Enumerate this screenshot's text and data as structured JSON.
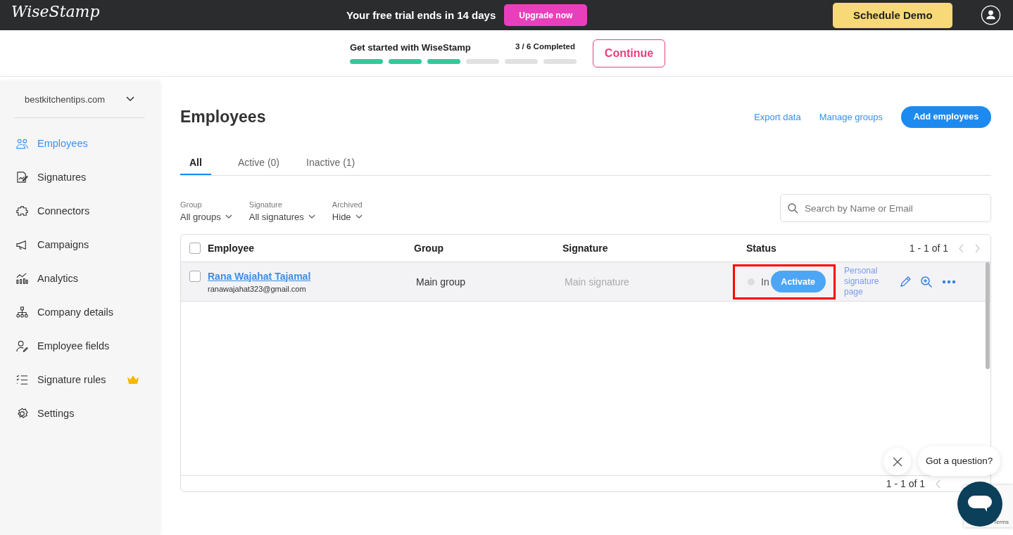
{
  "topbar": {
    "logo": "WiseStamp",
    "trial_message": "Your free trial ends in 14 days",
    "upgrade_button": "Upgrade now",
    "demo_button": "Schedule Demo"
  },
  "onboarding": {
    "title": "Get started with WiseStamp",
    "progress_text": "3 / 6 Completed",
    "steps": [
      {
        "completed": true
      },
      {
        "completed": true
      },
      {
        "completed": true
      },
      {
        "completed": false
      },
      {
        "completed": false
      },
      {
        "completed": false
      }
    ],
    "continue_button": "Continue"
  },
  "sidebar": {
    "account": "bestkitchentips.com",
    "items": [
      {
        "label": "Employees",
        "selected": true,
        "premium": false
      },
      {
        "label": "Signatures",
        "selected": false,
        "premium": false
      },
      {
        "label": "Connectors",
        "selected": false,
        "premium": false
      },
      {
        "label": "Campaigns",
        "selected": false,
        "premium": false
      },
      {
        "label": "Analytics",
        "selected": false,
        "premium": false
      },
      {
        "label": "Company details",
        "selected": false,
        "premium": false
      },
      {
        "label": "Employee fields",
        "selected": false,
        "premium": false
      },
      {
        "label": "Signature rules",
        "selected": false,
        "premium": true
      },
      {
        "label": "Settings",
        "selected": false,
        "premium": false
      }
    ]
  },
  "page": {
    "title": "Employees",
    "actions": [
      "Export data",
      "Manage groups"
    ],
    "primary_button": "Add employees"
  },
  "tabs": [
    {
      "label": "All",
      "selected": true
    },
    {
      "label": "Active (0)",
      "selected": false
    },
    {
      "label": "Inactive (1)",
      "selected": false
    }
  ],
  "filters": [
    {
      "label": "Group",
      "value": "All groups"
    },
    {
      "label": "Signature",
      "value": "All signatures"
    },
    {
      "label": "Archived",
      "value": "Hide"
    }
  ],
  "search": {
    "placeholder": "Search by Name or Email"
  },
  "table": {
    "columns": [
      "Employee",
      "Group",
      "Signature",
      "Status"
    ],
    "pagination": "1 - 1 of 1",
    "footer_pagination": "1 - 1 of 1",
    "all_checked": false,
    "rows": [
      {
        "checked": false,
        "name": "Rana Wajahat Tajamal",
        "email": "ranawajahat323@gmail.com",
        "group": "Main group",
        "signature": "Main signature",
        "status": "In",
        "action_button": "Activate",
        "link": "Personal signature page"
      }
    ]
  },
  "chat": {
    "bubble": "Got a question?"
  },
  "recaptcha": {
    "text": "Terms"
  }
}
